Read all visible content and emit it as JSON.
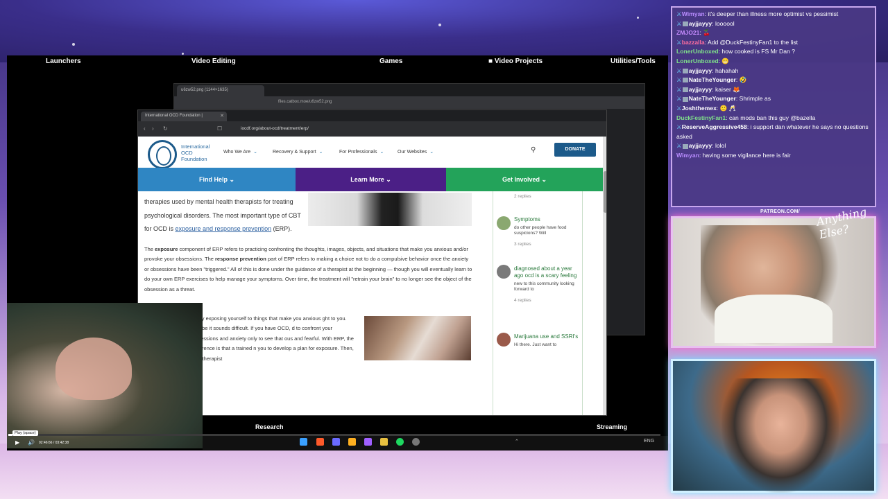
{
  "launchers": {
    "launchers": "Launchers",
    "video_editing": "Video Editing",
    "games": "Games",
    "video_projects": "Video Projects",
    "utilities": "Utilities/Tools",
    "research": "Research",
    "streaming": "Streaming"
  },
  "back_window": {
    "tab_title": "u6zw52.png (1144×1635)",
    "url": "files.catbox.moe/u6zw52.png"
  },
  "front_window": {
    "tab_title": "International OCD Foundation |",
    "url": "iocdf.org/about-ocd/treatment/erp/"
  },
  "site": {
    "logo_text": "International OCD Foundation",
    "menu": [
      "Who We Are",
      "Recovery & Support",
      "For Professionals",
      "Our Websites"
    ],
    "donate": "DONATE",
    "nav": [
      "Find Help",
      "Learn More",
      "Get Involved"
    ],
    "nav_colors": [
      "#2f86c3",
      "#4b1f86",
      "#23a35a"
    ],
    "p1_a": "therapies used by mental health therapists for treating psychological disorders. The most important type of CBT for OCD is ",
    "p1_link": "exposure and response prevention",
    "p1_b": " (ERP).",
    "p2_a": "The ",
    "p2_b1": "exposure",
    "p2_c": " component of ERP refers to practicing confronting the thoughts, images, objects, and situations that make you anxious and/or provoke your obsessions. The ",
    "p2_b2": "response prevention",
    "p2_d": " part of ERP refers to making a choice not to do a compulsive behavior once the anxiety or obsessions have been \"triggered.\" All of this is done under the guidance of a therapist at the beginning — though you will eventually learn to do your own ERP exercises to help manage your symptoms. Over time, the treatment will \"retrain your brain\" to no longer see the object of the obsession as a threat.",
    "p3": "efully exposing yourself to things that make you anxious ght to you. Maybe it sounds difficult. If you have OCD, d to confront your obsessions and anxiety only to see that ous and fearful. With ERP, the difference is that a trained n you to develop a plan for exposure. Then, that therapist",
    "sidebar": [
      {
        "title": "",
        "snippet": "",
        "replies": "2 replies"
      },
      {
        "title": "Symptoms",
        "snippet": "do other people have food suspicions? Will",
        "replies": "3 replies"
      },
      {
        "title": "diagnosed about a year ago ocd is a scary feeling",
        "snippet": "new to this community looking forward to",
        "replies": "4 replies"
      },
      {
        "title": "Marijuana use and SSRI's",
        "snippet": "Hi there. Just want to",
        "replies": ""
      }
    ]
  },
  "player": {
    "tooltip": "Play (space)",
    "timecode": "02:46:66 / 03:42:38",
    "progress_fraction": 0.006
  },
  "chat": [
    {
      "user": "Wimyan",
      "user_color": "#b98cff",
      "badges": 1,
      "msg": "it's deeper than illness more optimist vs pessimist"
    },
    {
      "user": "ayjjayyy",
      "user_color": "#ffffff",
      "badges": 2,
      "msg": "loooool"
    },
    {
      "user": "ZMJO21",
      "user_color": "#c68cff",
      "badges": 0,
      "msg": "🍒"
    },
    {
      "user": "bazzalla",
      "user_color": "#ff6fa0",
      "badges": 1,
      "msg": "Add @DuckFestinyFan1 to the list"
    },
    {
      "user": "LonerUnboxed",
      "user_color": "#7fe08a",
      "badges": 0,
      "msg": "how cooked is FS Mr Dan ?"
    },
    {
      "user": "LonerUnboxed",
      "user_color": "#7fe08a",
      "badges": 0,
      "msg": "😬"
    },
    {
      "user": "ayjjayyy",
      "user_color": "#ffffff",
      "badges": 2,
      "msg": "hahahah"
    },
    {
      "user": "NateTheYounger",
      "user_color": "#ffffff",
      "badges": 2,
      "msg": "🤣"
    },
    {
      "user": "ayjjayyy",
      "user_color": "#ffffff",
      "badges": 2,
      "msg": "kaiser 🦊"
    },
    {
      "user": "NateTheYounger",
      "user_color": "#ffffff",
      "badges": 2,
      "msg": "Shrimple as"
    },
    {
      "user": "Joshthemex",
      "user_color": "#ffffff",
      "badges": 1,
      "msg": "🙂 🥂"
    },
    {
      "user": "DuckFestinyFan1",
      "user_color": "#7fe08a",
      "badges": 0,
      "msg": "can mods ban this guy @bazella"
    },
    {
      "user": "ReserveAggressive458",
      "user_color": "#ffffff",
      "badges": 1,
      "msg": "i support dan whatever he says no questions asked"
    },
    {
      "user": "ayjjayyy",
      "user_color": "#ffffff",
      "badges": 2,
      "msg": "lolol"
    },
    {
      "user": "Wimyan",
      "user_color": "#b98cff",
      "badges": 0,
      "msg": "having some vigilance here is fair"
    }
  ],
  "patreon": "PATREON.COM/",
  "brand_script": "Anything Else?"
}
